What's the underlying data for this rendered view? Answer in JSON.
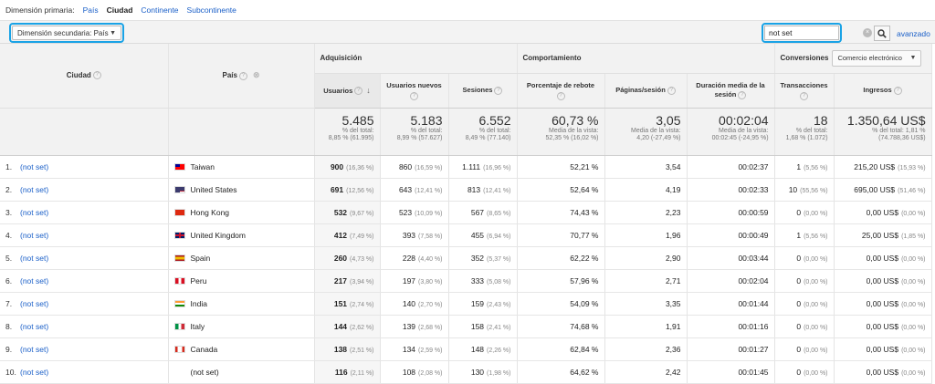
{
  "dims": {
    "label": "Dimensión primaria:",
    "items": [
      "País",
      "Ciudad",
      "Continente",
      "Subcontinente"
    ]
  },
  "secondary": {
    "label": "Dimensión secundaria: País"
  },
  "search": {
    "value": "not set",
    "advanced": "avanzado"
  },
  "headers": {
    "city": "Ciudad",
    "country": "País",
    "acq": "Adquisición",
    "beh": "Comportamiento",
    "conv": "Conversiones",
    "conv_select": "Comercio electrónico",
    "users": "Usuarios",
    "new_users": "Usuarios nuevos",
    "sessions": "Sesiones",
    "bounce": "Porcentaje de rebote",
    "pages": "Páginas/sesión",
    "duration": "Duración media de la sesión",
    "transactions": "Transacciones",
    "revenue": "Ingresos"
  },
  "totals": {
    "users": {
      "v": "5.485",
      "s1": "% del total:",
      "s2": "8,85 % (61.995)"
    },
    "new_users": {
      "v": "5.183",
      "s1": "% del total:",
      "s2": "8,99 % (57.627)"
    },
    "sessions": {
      "v": "6.552",
      "s1": "% del total:",
      "s2": "8,49 % (77.140)"
    },
    "bounce": {
      "v": "60,73 %",
      "s1": "Media de la vista:",
      "s2": "52,35 % (16,02 %)"
    },
    "pages": {
      "v": "3,05",
      "s1": "Media de la vista:",
      "s2": "4,20 (-27,49 %)"
    },
    "duration": {
      "v": "00:02:04",
      "s1": "Media de la vista:",
      "s2": "00:02:45 (-24,95 %)"
    },
    "transactions": {
      "v": "18",
      "s1": "% del total:",
      "s2": "1,68 % (1.072)"
    },
    "revenue": {
      "v": "1.350,64 US$",
      "s1": "% del total: 1,81 %",
      "s2": "(74.788,36 US$)"
    }
  },
  "rows": [
    {
      "n": "1.",
      "city": "(not set)",
      "country": "Taiwan",
      "flag": "tw",
      "users": "900",
      "users_p": "(16,36 %)",
      "new": "860",
      "new_p": "(16,59 %)",
      "ses": "1.111",
      "ses_p": "(16,96 %)",
      "bounce": "52,21 %",
      "pages": "3,54",
      "dur": "00:02:37",
      "tr": "1",
      "tr_p": "(5,56 %)",
      "rev": "215,20 US$",
      "rev_p": "(15,93 %)"
    },
    {
      "n": "2.",
      "city": "(not set)",
      "country": "United States",
      "flag": "us",
      "users": "691",
      "users_p": "(12,56 %)",
      "new": "643",
      "new_p": "(12,41 %)",
      "ses": "813",
      "ses_p": "(12,41 %)",
      "bounce": "52,64 %",
      "pages": "4,19",
      "dur": "00:02:33",
      "tr": "10",
      "tr_p": "(55,56 %)",
      "rev": "695,00 US$",
      "rev_p": "(51,46 %)"
    },
    {
      "n": "3.",
      "city": "(not set)",
      "country": "Hong Kong",
      "flag": "hk",
      "users": "532",
      "users_p": "(9,67 %)",
      "new": "523",
      "new_p": "(10,09 %)",
      "ses": "567",
      "ses_p": "(8,65 %)",
      "bounce": "74,43 %",
      "pages": "2,23",
      "dur": "00:00:59",
      "tr": "0",
      "tr_p": "(0,00 %)",
      "rev": "0,00 US$",
      "rev_p": "(0,00 %)"
    },
    {
      "n": "4.",
      "city": "(not set)",
      "country": "United Kingdom",
      "flag": "gb",
      "users": "412",
      "users_p": "(7,49 %)",
      "new": "393",
      "new_p": "(7,58 %)",
      "ses": "455",
      "ses_p": "(6,94 %)",
      "bounce": "70,77 %",
      "pages": "1,96",
      "dur": "00:00:49",
      "tr": "1",
      "tr_p": "(5,56 %)",
      "rev": "25,00 US$",
      "rev_p": "(1,85 %)"
    },
    {
      "n": "5.",
      "city": "(not set)",
      "country": "Spain",
      "flag": "es",
      "users": "260",
      "users_p": "(4,73 %)",
      "new": "228",
      "new_p": "(4,40 %)",
      "ses": "352",
      "ses_p": "(5,37 %)",
      "bounce": "62,22 %",
      "pages": "2,90",
      "dur": "00:03:44",
      "tr": "0",
      "tr_p": "(0,00 %)",
      "rev": "0,00 US$",
      "rev_p": "(0,00 %)"
    },
    {
      "n": "6.",
      "city": "(not set)",
      "country": "Peru",
      "flag": "pe",
      "users": "217",
      "users_p": "(3,94 %)",
      "new": "197",
      "new_p": "(3,80 %)",
      "ses": "333",
      "ses_p": "(5,08 %)",
      "bounce": "57,96 %",
      "pages": "2,71",
      "dur": "00:02:04",
      "tr": "0",
      "tr_p": "(0,00 %)",
      "rev": "0,00 US$",
      "rev_p": "(0,00 %)"
    },
    {
      "n": "7.",
      "city": "(not set)",
      "country": "India",
      "flag": "in",
      "users": "151",
      "users_p": "(2,74 %)",
      "new": "140",
      "new_p": "(2,70 %)",
      "ses": "159",
      "ses_p": "(2,43 %)",
      "bounce": "54,09 %",
      "pages": "3,35",
      "dur": "00:01:44",
      "tr": "0",
      "tr_p": "(0,00 %)",
      "rev": "0,00 US$",
      "rev_p": "(0,00 %)"
    },
    {
      "n": "8.",
      "city": "(not set)",
      "country": "Italy",
      "flag": "it",
      "users": "144",
      "users_p": "(2,62 %)",
      "new": "139",
      "new_p": "(2,68 %)",
      "ses": "158",
      "ses_p": "(2,41 %)",
      "bounce": "74,68 %",
      "pages": "1,91",
      "dur": "00:01:16",
      "tr": "0",
      "tr_p": "(0,00 %)",
      "rev": "0,00 US$",
      "rev_p": "(0,00 %)"
    },
    {
      "n": "9.",
      "city": "(not set)",
      "country": "Canada",
      "flag": "ca",
      "users": "138",
      "users_p": "(2,51 %)",
      "new": "134",
      "new_p": "(2,59 %)",
      "ses": "148",
      "ses_p": "(2,26 %)",
      "bounce": "62,84 %",
      "pages": "2,36",
      "dur": "00:01:27",
      "tr": "0",
      "tr_p": "(0,00 %)",
      "rev": "0,00 US$",
      "rev_p": "(0,00 %)"
    },
    {
      "n": "10.",
      "city": "(not set)",
      "country": "(not set)",
      "flag": "",
      "users": "116",
      "users_p": "(2,11 %)",
      "new": "108",
      "new_p": "(2,08 %)",
      "ses": "130",
      "ses_p": "(1,98 %)",
      "bounce": "64,62 %",
      "pages": "2,42",
      "dur": "00:01:45",
      "tr": "0",
      "tr_p": "(0,00 %)",
      "rev": "0,00 US$",
      "rev_p": "(0,00 %)"
    }
  ]
}
